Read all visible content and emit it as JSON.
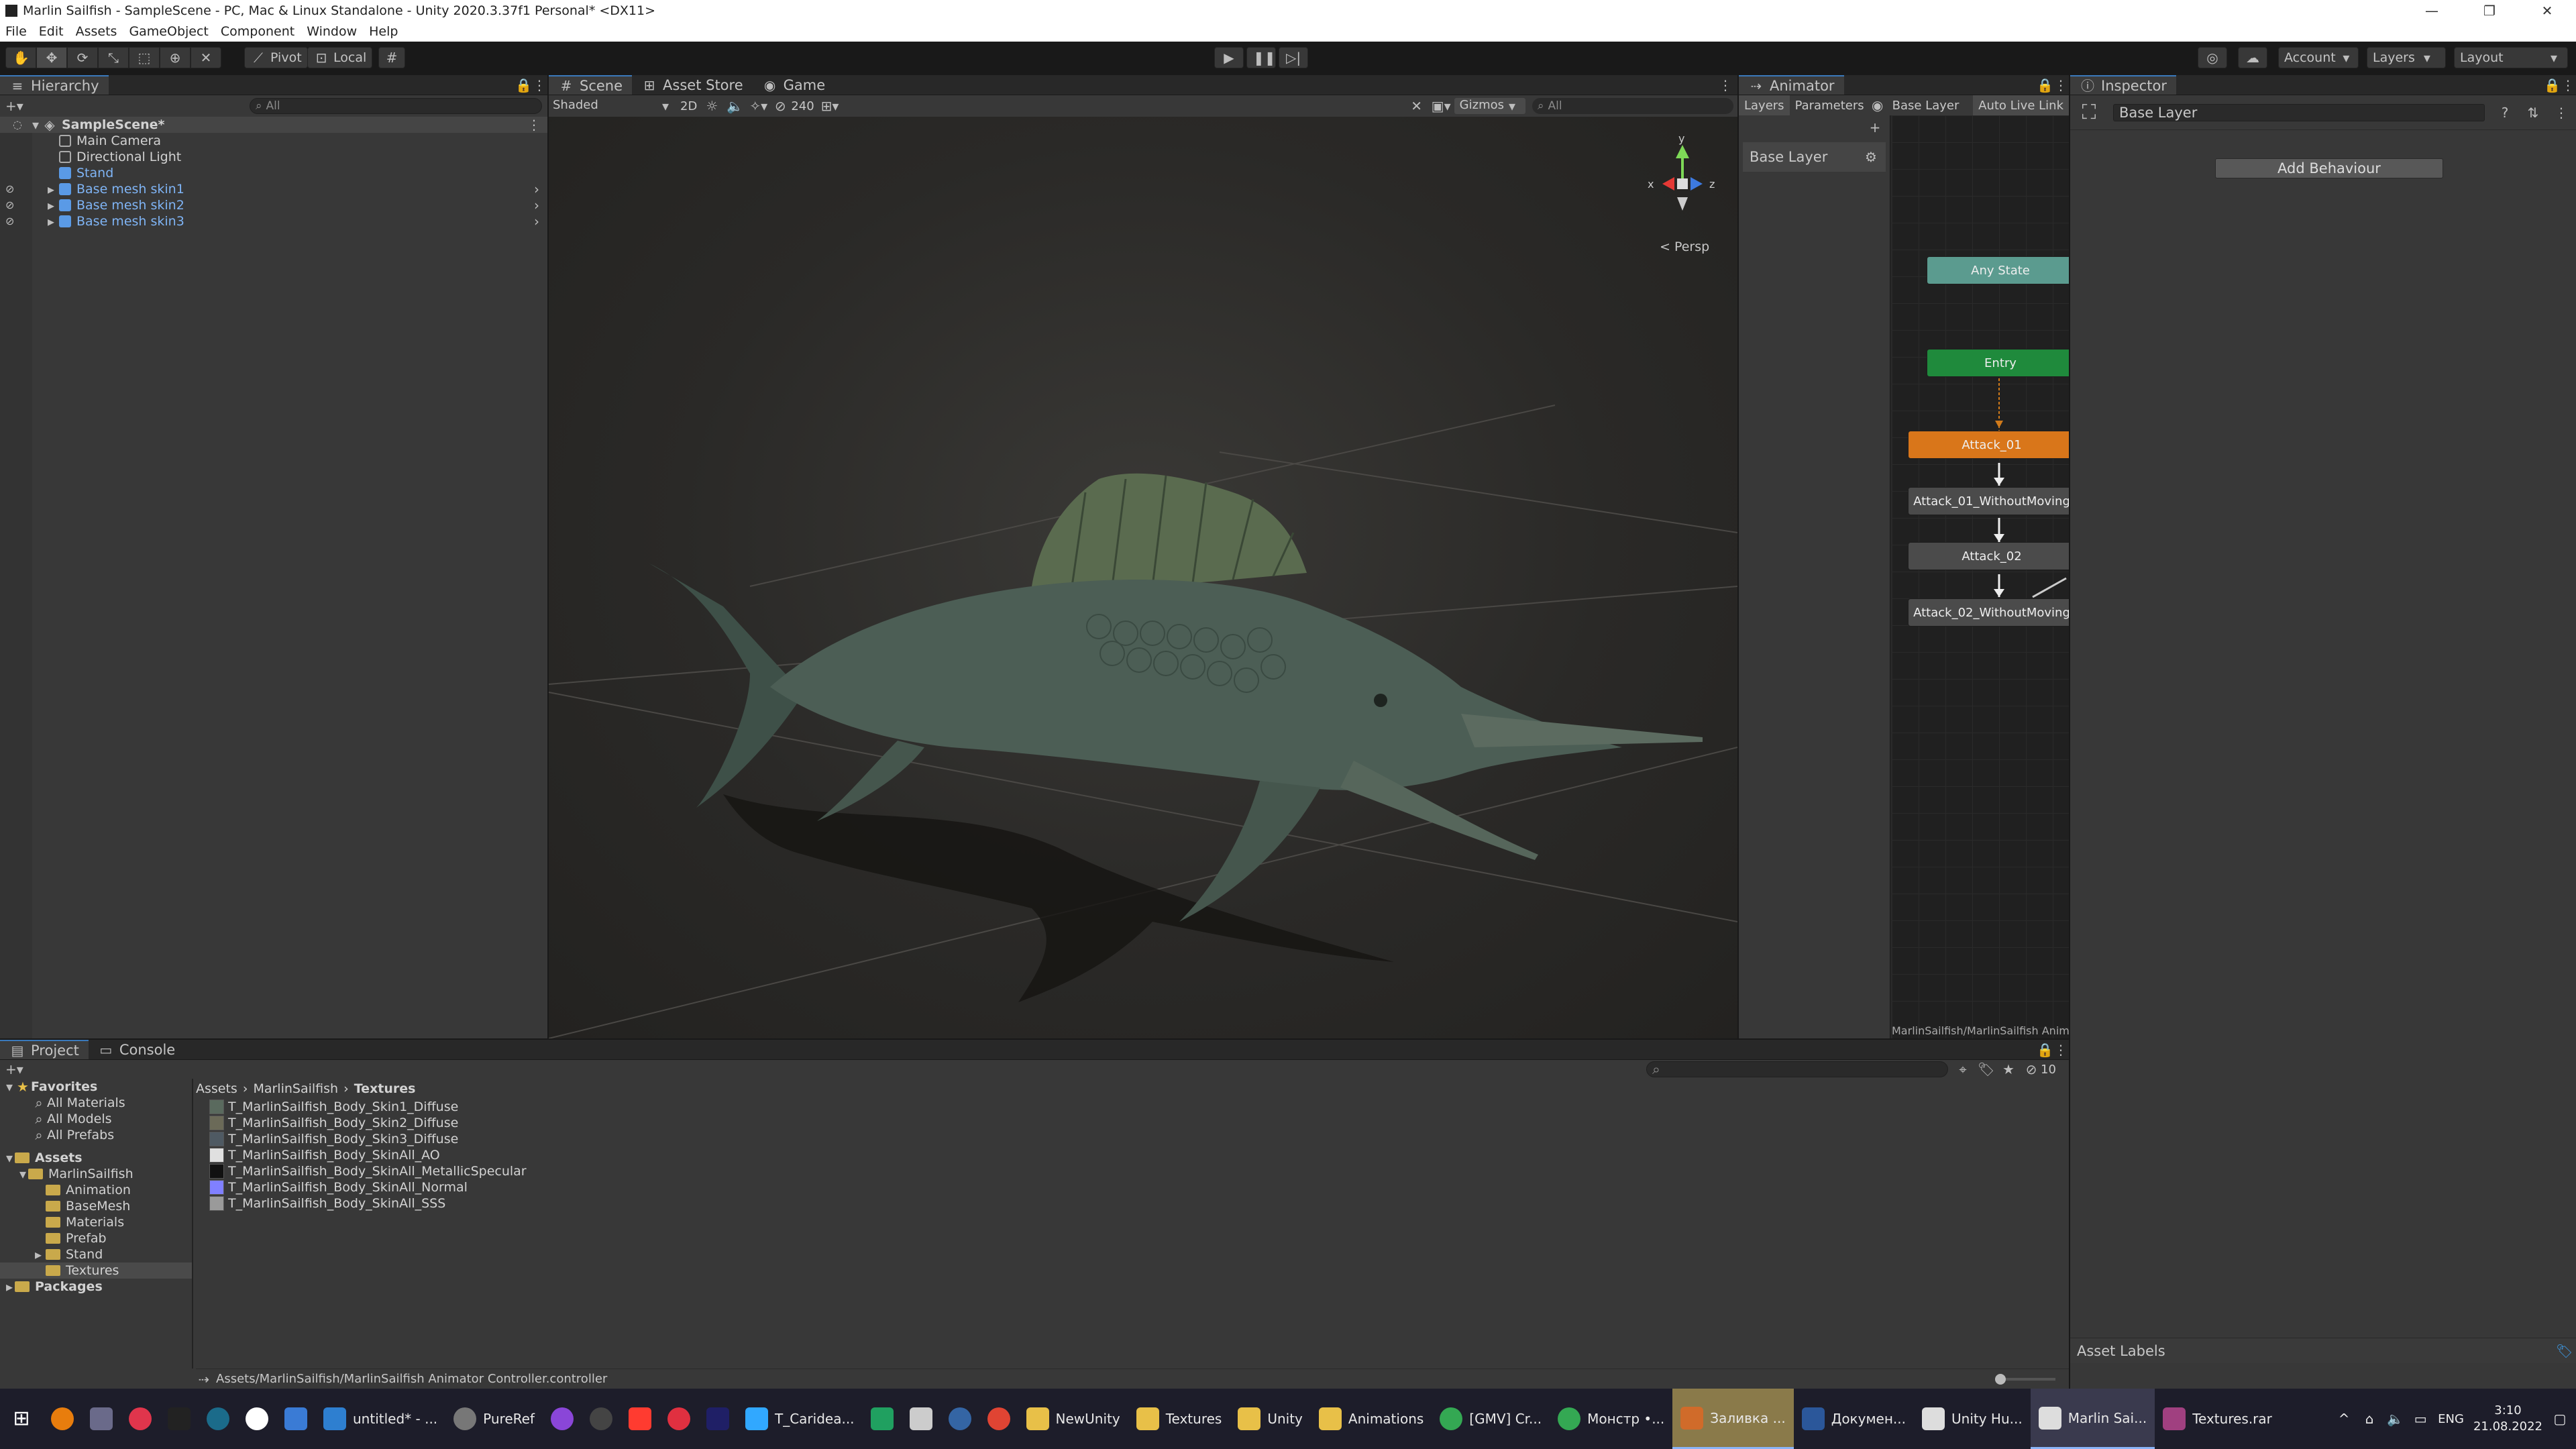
{
  "window": {
    "title": "Marlin Sailfish - SampleScene - PC, Mac & Linux Standalone - Unity 2020.3.37f1 Personal* <DX11>",
    "controls": [
      "—",
      "❐",
      "✕"
    ]
  },
  "menu": [
    "File",
    "Edit",
    "Assets",
    "GameObject",
    "Component",
    "Window",
    "Help"
  ],
  "toolbar": {
    "pivot": "Pivot",
    "local": "Local",
    "account": "Account",
    "layers": "Layers",
    "layout": "Layout"
  },
  "hierarchy": {
    "tab": "Hierarchy",
    "search_placeholder": "All",
    "scene": "SampleScene*",
    "items": [
      {
        "label": "Main Camera",
        "prefab": false
      },
      {
        "label": "Directional Light",
        "prefab": false
      },
      {
        "label": "Stand",
        "prefab": true
      },
      {
        "label": "Base mesh skin1",
        "prefab": true
      },
      {
        "label": "Base mesh skin2",
        "prefab": true
      },
      {
        "label": "Base mesh skin3",
        "prefab": true
      }
    ]
  },
  "scene": {
    "tabs": [
      "Scene",
      "Asset Store",
      "Game"
    ],
    "shading": "Shaded",
    "mode2d": "2D",
    "counter": "240",
    "gizmos": "Gizmos",
    "search_placeholder": "All",
    "persp": "< Persp",
    "axes": {
      "x": "x",
      "y": "y",
      "z": "z"
    }
  },
  "animator": {
    "tab": "Animator",
    "subtabs": [
      "Layers",
      "Parameters"
    ],
    "breadcrumb": "Base Layer",
    "live_link": "Auto Live Link",
    "layer_name": "Base Layer",
    "states": [
      "Any State",
      "Entry",
      "Attack_01",
      "Attack_01_WithoutMoving",
      "Attack_02",
      "Attack_02_WithoutMoving"
    ],
    "footer": "MarlinSailfish/MarlinSailfish Animato"
  },
  "inspector": {
    "tab": "Inspector",
    "title": "Base Layer",
    "add_behaviour": "Add Behaviour",
    "asset_labels": "Asset Labels"
  },
  "project": {
    "tabs": [
      "Project",
      "Console"
    ],
    "breadcrumb": [
      "Assets",
      "MarlinSailfish",
      "Textures"
    ],
    "count": "10",
    "favorites_label": "Favorites",
    "favorites": [
      "All Materials",
      "All Models",
      "All Prefabs"
    ],
    "assets_label": "Assets",
    "root_folder": "MarlinSailfish",
    "folders": [
      "Animation",
      "BaseMesh",
      "Materials",
      "Prefab",
      "Stand",
      "Textures"
    ],
    "packages_label": "Packages",
    "files": [
      {
        "name": "T_MarlinSailfish_Body_Skin1_Diffuse",
        "color": "#5a6a5e"
      },
      {
        "name": "T_MarlinSailfish_Body_Skin2_Diffuse",
        "color": "#6b6a58"
      },
      {
        "name": "T_MarlinSailfish_Body_Skin3_Diffuse",
        "color": "#4f5a63"
      },
      {
        "name": "T_MarlinSailfish_Body_SkinAll_AO",
        "color": "#e0e0e0"
      },
      {
        "name": "T_MarlinSailfish_Body_SkinAll_MetallicSpecular",
        "color": "#111111"
      },
      {
        "name": "T_MarlinSailfish_Body_SkinAll_Normal",
        "color": "#8080ff"
      },
      {
        "name": "T_MarlinSailfish_Body_SkinAll_SSS",
        "color": "#9a9a9a"
      }
    ],
    "path": "Assets/MarlinSailfish/MarlinSailfish Animator Controller.controller"
  },
  "taskbar": {
    "items": [
      {
        "label": "untitled* - ...",
        "color": "#2e7fd0"
      },
      {
        "label": "PureRef",
        "color": "#777777"
      },
      {
        "label": "",
        "color": "#8a46d8"
      },
      {
        "label": "",
        "color": "#444444"
      },
      {
        "label": "",
        "color": "#ff3b30"
      },
      {
        "label": "",
        "color": "#e03040"
      },
      {
        "label": "",
        "color": "#1f1f66"
      },
      {
        "label": "T_Caridea...",
        "color": "#31a8ff"
      },
      {
        "label": "",
        "color": "#20a060"
      },
      {
        "label": "",
        "color": "#cccccc"
      },
      {
        "label": "",
        "color": "#3465a4"
      },
      {
        "label": "",
        "color": "#e04433"
      },
      {
        "label": "NewUnity",
        "color": "#e8c048"
      },
      {
        "label": "Textures",
        "color": "#e8c048"
      },
      {
        "label": "Unity",
        "color": "#e8c048"
      },
      {
        "label": "Animations",
        "color": "#e8c048"
      },
      {
        "label": "[GMV] Cr...",
        "color": "#34a853"
      },
      {
        "label": "Монстр •...",
        "color": "#34a853"
      },
      {
        "label": "Заливка ...",
        "color": "#d06b2a"
      },
      {
        "label": "Докумен...",
        "color": "#2b579a"
      },
      {
        "label": "Unity Hu...",
        "color": "#dddddd"
      },
      {
        "label": "Marlin Sai...",
        "color": "#dddddd"
      },
      {
        "label": "Textures.rar",
        "color": "#a04080"
      }
    ],
    "lang": "ENG",
    "time": "3:10",
    "date": "21.08.2022"
  }
}
